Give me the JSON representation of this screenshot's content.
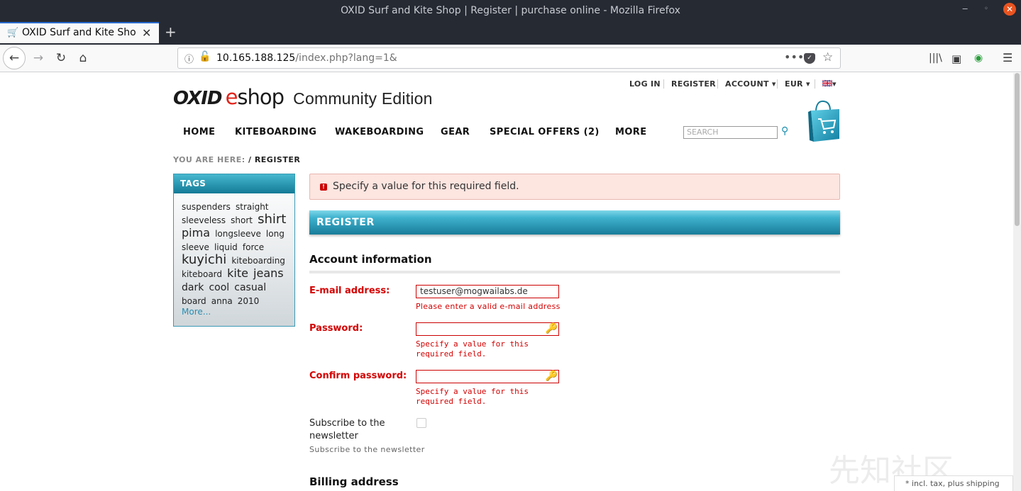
{
  "browser": {
    "window_title": "OXID Surf and Kite Shop | Register | purchase online - Mozilla Firefox",
    "tab_title": "OXID Surf and Kite Shop",
    "url_host": "10.165.188.125",
    "url_path": "/index.php?lang=1&",
    "new_tab": "+",
    "more_actions": "•••"
  },
  "header": {
    "links": {
      "login": "LOG IN",
      "register": "REGISTER",
      "account": "ACCOUNT ▾",
      "currency": "EUR ▾",
      "language": "▾"
    },
    "logo": {
      "oxid": "OXID",
      "e": "e",
      "shop": "shop",
      "edition": "Community Edition"
    },
    "nav": [
      "HOME",
      "KITEBOARDING",
      "WAKEBOARDING",
      "GEAR",
      "SPECIAL OFFERS (2)",
      "MORE"
    ],
    "search_placeholder": "SEARCH"
  },
  "breadcrumb": {
    "label": "YOU ARE HERE:",
    "current": "/ REGISTER"
  },
  "sidebar": {
    "tags_title": "TAGS",
    "tags": [
      {
        "text": "suspenders",
        "size": 12
      },
      {
        "text": "straight",
        "size": 12
      },
      {
        "text": "sleeveless",
        "size": 12
      },
      {
        "text": "short",
        "size": 12
      },
      {
        "text": "shirt",
        "size": 18
      },
      {
        "text": "pima",
        "size": 16
      },
      {
        "text": "longsleeve",
        "size": 12
      },
      {
        "text": "long",
        "size": 12
      },
      {
        "text": "sleeve",
        "size": 12
      },
      {
        "text": "liquid",
        "size": 12
      },
      {
        "text": "force",
        "size": 12
      },
      {
        "text": "kuyichi",
        "size": 18
      },
      {
        "text": "kiteboarding",
        "size": 12
      },
      {
        "text": "kiteboard",
        "size": 12
      },
      {
        "text": "kite",
        "size": 16
      },
      {
        "text": "jeans",
        "size": 16
      },
      {
        "text": "dark",
        "size": 14
      },
      {
        "text": "cool",
        "size": 14
      },
      {
        "text": "casual",
        "size": 14
      },
      {
        "text": "board",
        "size": 12
      },
      {
        "text": "anna",
        "size": 12
      },
      {
        "text": "2010",
        "size": 12
      }
    ],
    "more": "More..."
  },
  "main": {
    "error_message": "Specify a value for this required field.",
    "register_heading": "REGISTER",
    "account_heading": "Account information",
    "email_label": "E-mail address:",
    "email_value": "testuser@mogwailabs.de",
    "email_error": "Please enter a valid e-mail address",
    "password_label": "Password:",
    "password_error": "Specify a value for this required field.",
    "confirm_label": "Confirm password:",
    "confirm_error": "Specify a value for this required field.",
    "subscribe_label": "Subscribe to the newsletter",
    "subscribe_help": "Subscribe to the newsletter",
    "billing_heading": "Billing address"
  },
  "footer_note": "* incl. tax, plus shipping",
  "watermark": "先知社区",
  "colors": {
    "accent": "#1a8fb0",
    "error": "#d40000",
    "chrome_dark": "#262a33"
  }
}
